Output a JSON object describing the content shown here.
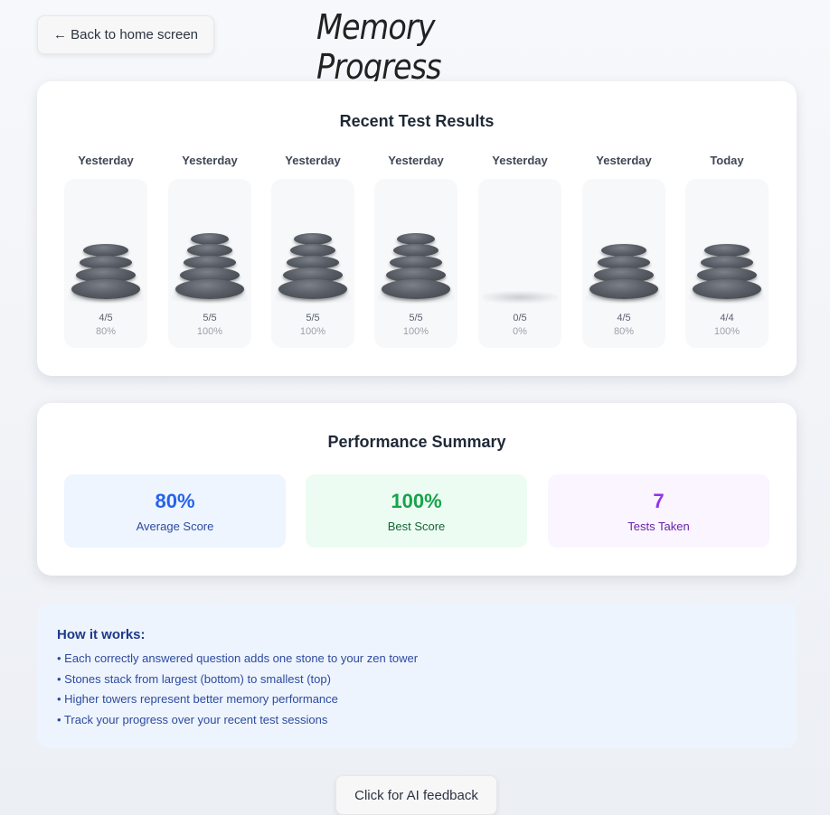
{
  "header": {
    "back_label": "← Back to home screen",
    "title": "Memory Progress"
  },
  "results": {
    "title": "Recent Test Results",
    "sessions": [
      {
        "day": "Yesterday",
        "score": "4/5",
        "percent": "80%",
        "stones": 4
      },
      {
        "day": "Yesterday",
        "score": "5/5",
        "percent": "100%",
        "stones": 5
      },
      {
        "day": "Yesterday",
        "score": "5/5",
        "percent": "100%",
        "stones": 5
      },
      {
        "day": "Yesterday",
        "score": "5/5",
        "percent": "100%",
        "stones": 5
      },
      {
        "day": "Yesterday",
        "score": "0/5",
        "percent": "0%",
        "stones": 0
      },
      {
        "day": "Yesterday",
        "score": "4/5",
        "percent": "80%",
        "stones": 4
      },
      {
        "day": "Today",
        "score": "4/4",
        "percent": "100%",
        "stones": 4
      }
    ]
  },
  "summary": {
    "title": "Performance Summary",
    "stats": [
      {
        "value": "80%",
        "label": "Average Score",
        "color": "#2563eb",
        "label_color": "#2c4aa0",
        "bg": "#eef5ff"
      },
      {
        "value": "100%",
        "label": "Best Score",
        "color": "#16a34a",
        "label_color": "#166534",
        "bg": "#ecfcf2"
      },
      {
        "value": "7",
        "label": "Tests Taken",
        "color": "#9333ea",
        "label_color": "#6b21a8",
        "bg": "#faf5ff"
      }
    ]
  },
  "info": {
    "title": "How it works:",
    "items": [
      "• Each correctly answered question adds one stone to your zen tower",
      "• Stones stack from largest (bottom) to smallest (top)",
      "• Higher towers represent better memory performance",
      "• Track your progress over your recent test sessions"
    ]
  },
  "feedback_label": "Click for AI feedback"
}
